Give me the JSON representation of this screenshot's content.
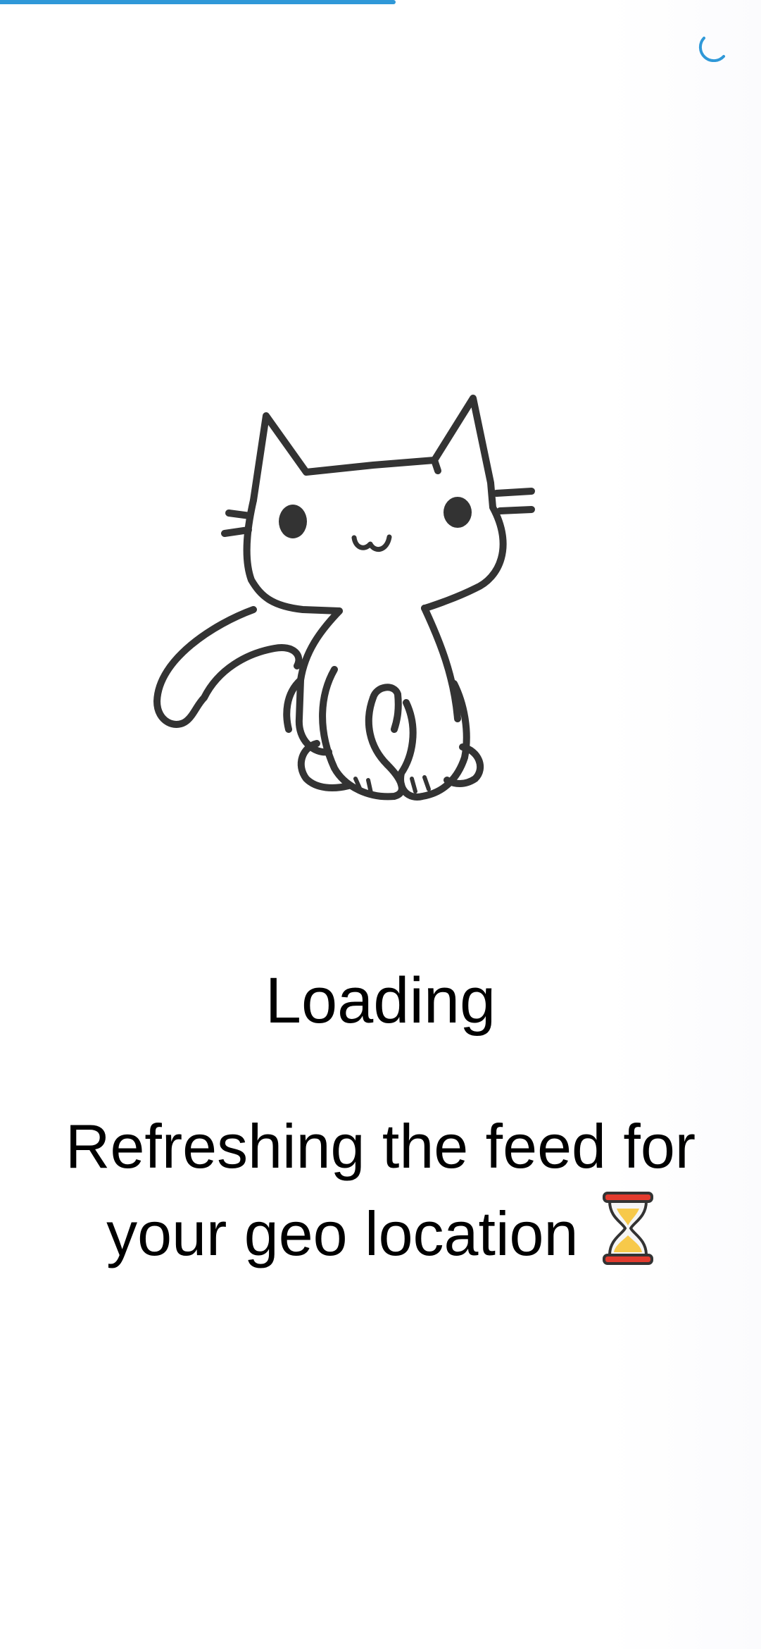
{
  "loading": {
    "progress_fraction": 0.52,
    "accent_color": "#2f98d8",
    "spinner_icon": "spinner-icon",
    "illustration_icon": "cat-illustration",
    "title": "Loading",
    "message": "Refreshing the feed for your geo location",
    "message_icon": "hourglass-icon"
  }
}
